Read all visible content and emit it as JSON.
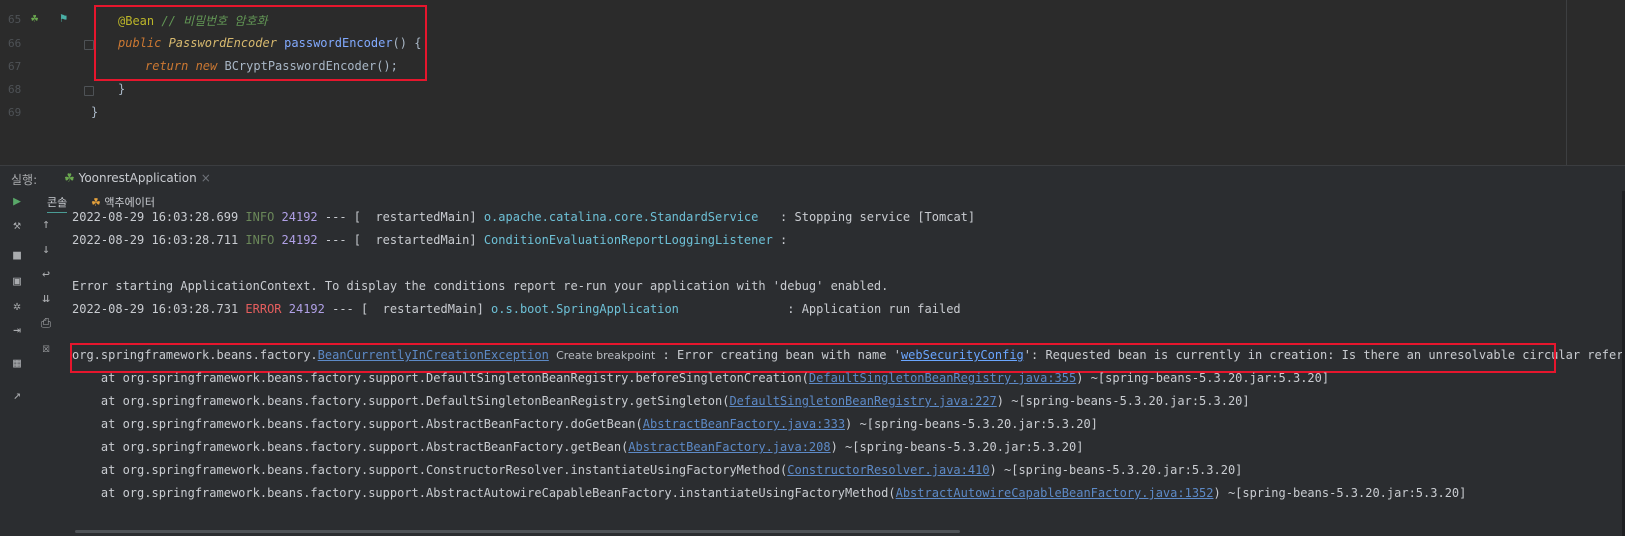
{
  "editor": {
    "line_numbers": [
      "65",
      "66",
      "67",
      "68",
      "69"
    ],
    "lines": [
      {
        "annotation": "@Bean",
        "comment": " // 비밀번호 암호화"
      },
      {
        "kw": "public ",
        "type": "PasswordEncoder ",
        "fn": "passwordEncoder",
        "rest": "() {"
      },
      {
        "kw": "return new ",
        "cls": "BCryptPasswordEncoder",
        "rest": "();"
      },
      {
        "text": "}"
      },
      {
        "text": "}"
      }
    ]
  },
  "run_panel": {
    "label": "실행:",
    "tab_label": "YoonrestApplication",
    "tab_close": "×",
    "subtabs": [
      "콘솔",
      "액추에이터"
    ]
  },
  "console": {
    "line1": {
      "ts": "2022-08-29 16:03:28.699 ",
      "level": "INFO",
      "pid": "24192",
      "sep": " --- [  restartedMain] ",
      "logger": "o.apache.catalina.core.StandardService",
      "msg": "   : Stopping service [Tomcat]"
    },
    "line2": {
      "ts": "2022-08-29 16:03:28.711 ",
      "level": "INFO",
      "pid": "24192",
      "sep": " --- [  restartedMain] ",
      "logger": "ConditionEvaluationReportLoggingListener",
      "msg": " :"
    },
    "line3": "Error starting ApplicationContext. To display the conditions report re-run your application with 'debug' enabled.",
    "line4": {
      "ts": "2022-08-29 16:03:28.731 ",
      "level": "ERROR",
      "pid": "24192",
      "sep": " --- [  restartedMain] ",
      "logger": "o.s.boot.SpringApplication",
      "msg": "               : Application run failed"
    },
    "exception": {
      "prefix": "org.springframework.beans.factory.",
      "exception_link": "BeanCurrentlyInCreationException",
      "create_breakpoint": "Create breakpoint",
      "msg1": " : Error creating bean with name '",
      "bean_link": "webSecurityConfig",
      "msg2": "': Requested bean is currently in creation: Is there an unresolvable circular reference?"
    },
    "stack": [
      {
        "pre": "    at org.springframework.beans.factory.support.DefaultSingletonBeanRegistry.beforeSingletonCreation(",
        "link": "DefaultSingletonBeanRegistry.java:355",
        "post": ") ~[spring-beans-5.3.20.jar:5.3.20]"
      },
      {
        "pre": "    at org.springframework.beans.factory.support.DefaultSingletonBeanRegistry.getSingleton(",
        "link": "DefaultSingletonBeanRegistry.java:227",
        "post": ") ~[spring-beans-5.3.20.jar:5.3.20]"
      },
      {
        "pre": "    at org.springframework.beans.factory.support.AbstractBeanFactory.doGetBean(",
        "link": "AbstractBeanFactory.java:333",
        "post": ") ~[spring-beans-5.3.20.jar:5.3.20]"
      },
      {
        "pre": "    at org.springframework.beans.factory.support.AbstractBeanFactory.getBean(",
        "link": "AbstractBeanFactory.java:208",
        "post": ") ~[spring-beans-5.3.20.jar:5.3.20]"
      },
      {
        "pre": "    at org.springframework.beans.factory.support.ConstructorResolver.instantiateUsingFactoryMethod(",
        "link": "ConstructorResolver.java:410",
        "post": ") ~[spring-beans-5.3.20.jar:5.3.20]"
      },
      {
        "pre": "    at org.springframework.beans.factory.support.AbstractAutowireCapableBeanFactory.instantiateUsingFactoryMethod(",
        "link": "AbstractAutowireCapableBeanFactory.java:1352",
        "post": ") ~[spring-beans-5.3.20.jar:5.3.20]"
      }
    ]
  },
  "icons": {
    "run": "▶",
    "wrench": "🔧",
    "stop": "■",
    "camera": "📷",
    "bug": "✲",
    "login": "⇥",
    "layout": "▦",
    "pin": "📌",
    "up": "↑",
    "down": "↓",
    "wrap": "⮐",
    "scroll_end": "⇊",
    "print": "⎙",
    "trash": "🗑"
  },
  "colors": {
    "highlight_box": "#e6162d",
    "accent": "#4a9c95"
  }
}
